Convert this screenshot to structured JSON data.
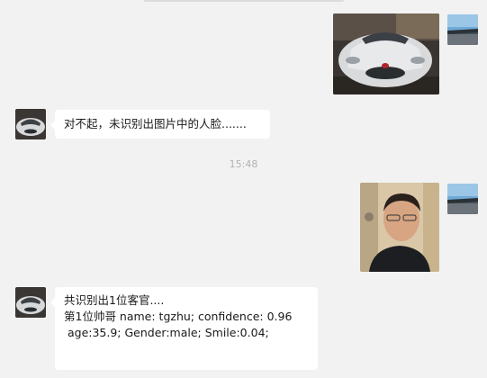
{
  "top_bar": {},
  "messages": [
    {
      "sender": "self",
      "type": "image",
      "content_icon": "car-photo"
    },
    {
      "sender": "other",
      "type": "text",
      "text": "对不起，未识别出图片中的人脸......."
    },
    {
      "type": "timestamp",
      "text": "15:48"
    },
    {
      "sender": "self",
      "type": "image",
      "content_icon": "person-photo"
    },
    {
      "sender": "other",
      "type": "text",
      "lines": [
        "共识别出1位客官....",
        "第1位帅哥 name: tgzhu; confidence: 0.96",
        " age:35.9; Gender:male; Smile:0.04;"
      ]
    }
  ],
  "avatars": {
    "self_icon": "road-landscape-avatar-icon",
    "other_icon": "white-car-avatar-icon"
  },
  "colors": {
    "background": "#f2f2f2",
    "bubble": "#ffffff",
    "timestamp": "#b2b2b2"
  }
}
